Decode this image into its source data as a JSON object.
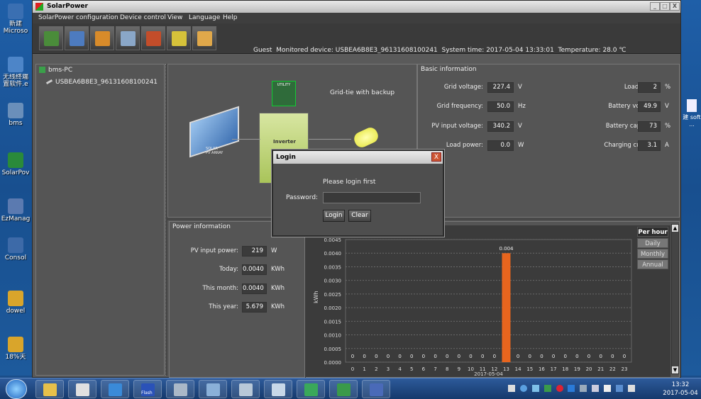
{
  "desktop": {
    "icons": [
      {
        "label": "新建 Microso",
        "color": "#3a6fb2"
      },
      {
        "label": "无线终端 置软件.e",
        "color": "#4d85c8"
      },
      {
        "label": "bms",
        "color": "#6a8fba"
      },
      {
        "label": "SolarPov",
        "color": "#2a8a3a"
      },
      {
        "label": "EzManag",
        "color": "#5b7ab0"
      },
      {
        "label": "Consol",
        "color": "#3d6aa8"
      },
      {
        "label": "dowel",
        "color": "#d9a52b"
      },
      {
        "label": "18%天",
        "color": "#d9a52b"
      }
    ],
    "right_icon_label": "建 soft ..."
  },
  "window": {
    "title": "SolarPower",
    "controls": [
      "_",
      "□",
      "X"
    ]
  },
  "menu": [
    "SolarPower configuration",
    "Device control",
    "View",
    "Language",
    "Help"
  ],
  "toolbar": {
    "buttons": [
      {
        "name": "chart-icon",
        "color": "#4a8c3a"
      },
      {
        "name": "tools-icon",
        "color": "#4d7bbf"
      },
      {
        "name": "report-icon",
        "color": "#d88b2a"
      },
      {
        "name": "monitor-icon",
        "color": "#8aa7c8"
      },
      {
        "name": "building-icon",
        "color": "#c34d2a"
      },
      {
        "name": "warning-icon",
        "color": "#d6c23a"
      },
      {
        "name": "users-icon",
        "color": "#e0a84a"
      }
    ]
  },
  "status": {
    "user": "Guest",
    "device_label": "Monitored device:",
    "device": "USBEA6B8E3_96131608100241",
    "time_label": "System time:",
    "time": "2017-05-04 13:33:01",
    "temp_label": "Temperature:",
    "temp": "28.0 ℃"
  },
  "tree": {
    "root": "bms-PC",
    "child": "USBEA6B8E3_96131608100241"
  },
  "diagram": {
    "mode": "Grid-tie with backup",
    "solar_label": "SOLAR\nPV ARRAY",
    "inverter_label": "Inverter",
    "utility_label": "UTILITY"
  },
  "basic": {
    "title": "Basic information",
    "left": [
      {
        "label": "Grid voltage:",
        "value": "227.4",
        "unit": "V"
      },
      {
        "label": "Grid frequency:",
        "value": "50.0",
        "unit": "Hz"
      },
      {
        "label": "PV input voltage:",
        "value": "340.2",
        "unit": "V"
      },
      {
        "label": "Load power:",
        "value": "0.0",
        "unit": "W"
      }
    ],
    "right": [
      {
        "label": "Load level:",
        "value": "2",
        "unit": "%"
      },
      {
        "label": "Battery voltage:",
        "value": "49.9",
        "unit": "V"
      },
      {
        "label": "Battery capacity:",
        "value": "73",
        "unit": "%"
      },
      {
        "label": "Charging current:",
        "value": "3.1",
        "unit": "A"
      }
    ]
  },
  "power": {
    "title": "Power information",
    "rows": [
      {
        "label": "PV input power:",
        "value": "219",
        "unit": "W"
      },
      {
        "label": "Today:",
        "value": "0.0040",
        "unit": "KWh"
      },
      {
        "label": "This month:",
        "value": "0.0040",
        "unit": "KWh"
      },
      {
        "label": "This year:",
        "value": "5.679",
        "unit": "KWh"
      }
    ]
  },
  "login": {
    "title": "Login",
    "close": "X",
    "message": "Please login first",
    "password_label": "Password:",
    "password_value": "",
    "login_button": "Login",
    "clear_button": "Clear"
  },
  "range_buttons": [
    "Per hour",
    "Daily",
    "Monthly",
    "Annual"
  ],
  "chart_data": {
    "type": "bar",
    "ylabel": "kWh",
    "xlabel": "2017-05-04",
    "ylim": [
      0,
      0.0045
    ],
    "yticks": [
      "0.0000",
      "0.0005",
      "0.0010",
      "0.0015",
      "0.0020",
      "0.0025",
      "0.0030",
      "0.0035",
      "0.0040",
      "0.0045"
    ],
    "categories": [
      "0",
      "1",
      "2",
      "3",
      "4",
      "5",
      "6",
      "7",
      "8",
      "9",
      "10",
      "11",
      "12",
      "13",
      "14",
      "15",
      "16",
      "17",
      "18",
      "19",
      "20",
      "21",
      "22",
      "23"
    ],
    "values": [
      0,
      0,
      0,
      0,
      0,
      0,
      0,
      0,
      0,
      0,
      0,
      0,
      0,
      0.004,
      0,
      0,
      0,
      0,
      0,
      0,
      0,
      0,
      0,
      0
    ],
    "data_labels": [
      "0",
      "0",
      "0",
      "0",
      "0",
      "0",
      "0",
      "0",
      "0",
      "0",
      "0",
      "0",
      "0",
      "0.004",
      "0",
      "0",
      "0",
      "0",
      "0",
      "0",
      "0",
      "0",
      "0",
      "0"
    ],
    "bar_color": "#e8651e",
    "grid": true
  },
  "taskbar": {
    "apps": [
      {
        "name": "folder-icon",
        "color": "#e7c04a"
      },
      {
        "name": "app-icon",
        "color": "#e0e0e0"
      },
      {
        "name": "ie-icon",
        "color": "#3a8ad8"
      },
      {
        "name": "flash-icon",
        "color": "#2a52b8"
      },
      {
        "name": "calculator-icon",
        "color": "#aab8c8"
      },
      {
        "name": "clock-icon",
        "color": "#8ab0d8"
      },
      {
        "name": "document-icon",
        "color": "#b8c8d8"
      },
      {
        "name": "window-icon",
        "color": "#c8d8e8"
      },
      {
        "name": "spreadsheet-icon",
        "color": "#3aa85a"
      },
      {
        "name": "solarpower-icon",
        "color": "#3a9a4a"
      },
      {
        "name": "editor-icon",
        "color": "#4a6ab8"
      }
    ],
    "flash_label": "Flash",
    "clock_time": "13:32",
    "clock_date": "2017-05-04"
  }
}
